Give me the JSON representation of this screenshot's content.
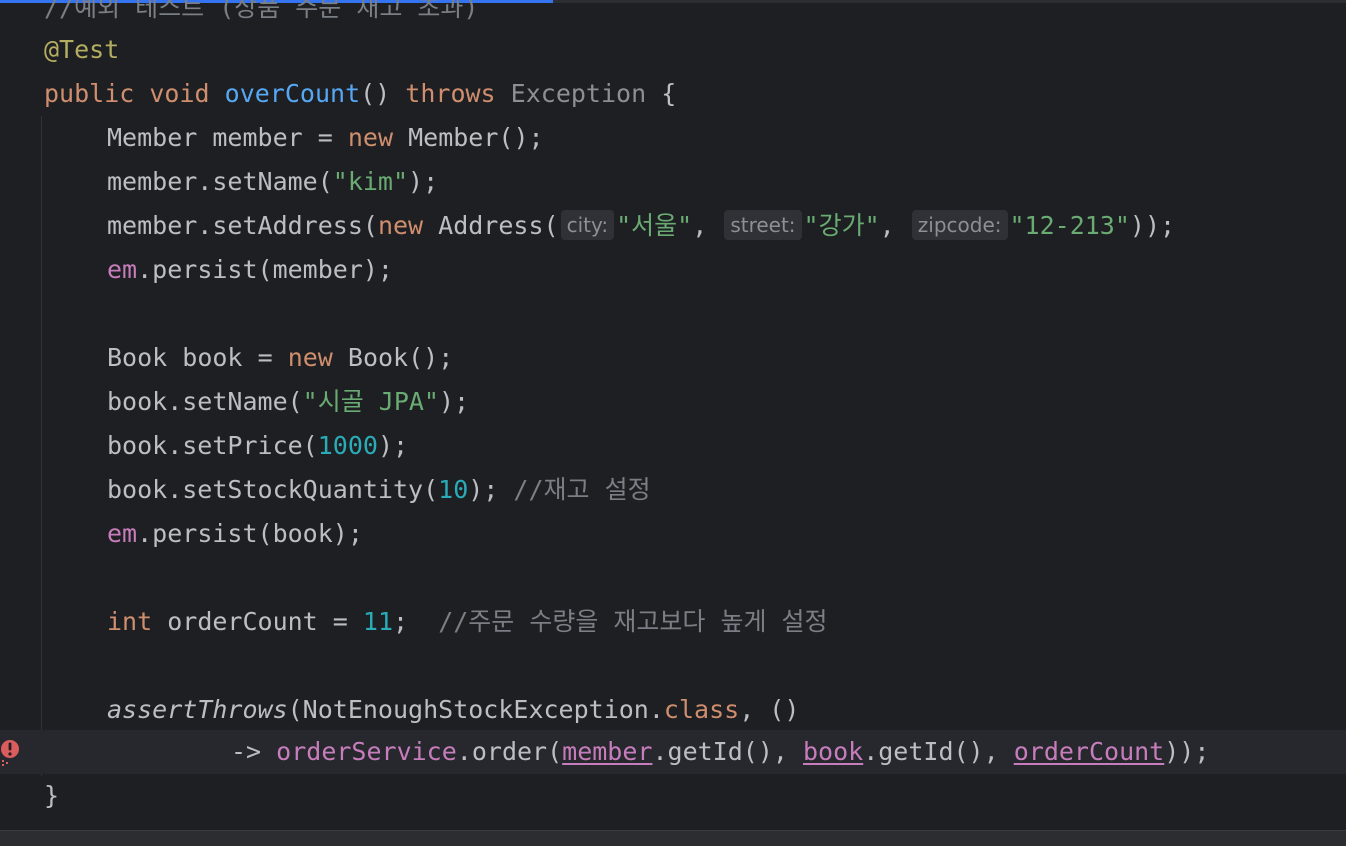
{
  "editor": {
    "lines": {
      "comment_top": "//예외 테스트 (상품 주문 재고 초과)",
      "annotation": "@Test",
      "sig": {
        "public": "public",
        "void": "void",
        "method": "overCount",
        "parens": "()",
        "throws": "throws",
        "exception": "Exception",
        "brace": "{"
      },
      "l1": {
        "type": "Member",
        "var": "member",
        "eq": "=",
        "new": "new",
        "ctor": "Member();"
      },
      "l2": {
        "text": "member.setName(",
        "str": "\"kim\"",
        "end": ");"
      },
      "l3": {
        "pre": "member.setAddress(",
        "new": "new",
        "ctor": "Address(",
        "hint_city": "city:",
        "s1": "\"서울\"",
        "hint_street": "street:",
        "s2": "\"강가\"",
        "hint_zip": "zipcode:",
        "s3": "\"12-213\"",
        "end": "));"
      },
      "l4": {
        "em": "em",
        "rest": ".persist(member);"
      },
      "l5": {
        "type": "Book",
        "var": "book",
        "eq": "=",
        "new": "new",
        "ctor": "Book();"
      },
      "l6": {
        "text": "book.setName(",
        "str": "\"시골 JPA\"",
        "end": ");"
      },
      "l7": {
        "text": "book.setPrice(",
        "num": "1000",
        "end": ");"
      },
      "l8": {
        "text": "book.setStockQuantity(",
        "num": "10",
        "end": ");",
        "cmt": "//재고 설정"
      },
      "l9": {
        "em": "em",
        "rest": ".persist(book);"
      },
      "l10": {
        "kw": "int",
        "var": "orderCount",
        "eq": "=",
        "num": "11",
        "end": ";",
        "cmt": "//주문 수량을 재고보다 높게 설정"
      },
      "l11": {
        "fn": "assertThrows",
        "open": "(NotEnoughStockException.",
        "cls": "class",
        "rest": ", ()"
      },
      "l12": {
        "arrow": "->",
        "svc": "orderService",
        "call": ".order(",
        "a1": "member",
        "g1": ".getId(), ",
        "a2": "book",
        "g2": ".getId(), ",
        "a3": "orderCount",
        "end": "));"
      },
      "close": "}"
    },
    "error_icon": "error-exclamation-icon"
  }
}
